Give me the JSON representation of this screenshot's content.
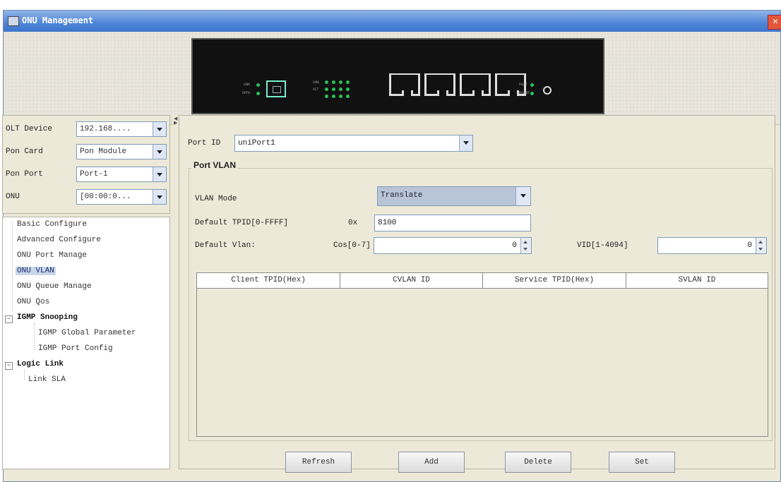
{
  "window": {
    "title": "ONU Management",
    "close_glyph": "✕"
  },
  "filters": {
    "olt_device": {
      "label": "OLT Device",
      "value": "192.168...."
    },
    "pon_card": {
      "label": "Pon Card",
      "value": "Pon Module"
    },
    "pon_port": {
      "label": "Pon Port",
      "value": "Port-1"
    },
    "onu": {
      "label": "ONU",
      "value": "[00:00:0..."
    }
  },
  "tree": {
    "items": [
      {
        "label": "Basic Configure"
      },
      {
        "label": "Advanced Configure"
      },
      {
        "label": "ONU Port Manage"
      },
      {
        "label": "ONU VLAN",
        "selected": true
      },
      {
        "label": "ONU Queue Manage"
      },
      {
        "label": "ONU Qos"
      },
      {
        "label": "IGMP Snooping",
        "group": true,
        "expanded": true
      },
      {
        "label": "IGMP Global Parameter"
      },
      {
        "label": "IGMP Port Config"
      },
      {
        "label": "Logic Link",
        "group": true,
        "expanded": true
      },
      {
        "label": "Link SLA"
      }
    ],
    "expanded_glyph": "−"
  },
  "port": {
    "label": "Port ID",
    "value": "uniPort1"
  },
  "port_vlan": {
    "title": "Port VLAN",
    "vlan_mode": {
      "label": "VLAN Mode",
      "value": "Translate"
    },
    "default_tpid": {
      "label": "Default TPID[0-FFFF]",
      "prefix": "0x",
      "value": "8100"
    },
    "default_vlan": {
      "label": "Default Vlan:",
      "cos_label": "Cos[0-7]",
      "cos_value": "0",
      "vid_label": "VID[1-4094]",
      "vid_value": "0"
    },
    "table": {
      "columns": [
        "Client TPID(Hex)",
        "CVLAN ID",
        "Service TPID(Hex)",
        "SVLAN ID"
      ],
      "rows": []
    }
  },
  "buttons": {
    "refresh": "Refresh",
    "add": "Add",
    "delete": "Delete",
    "set": "Set"
  },
  "colors": {
    "title_bar": "#3c75cc",
    "panel_bg": "#ece9d8",
    "selected_bg": "#c9d6ea",
    "led_green": "#29c15a"
  }
}
